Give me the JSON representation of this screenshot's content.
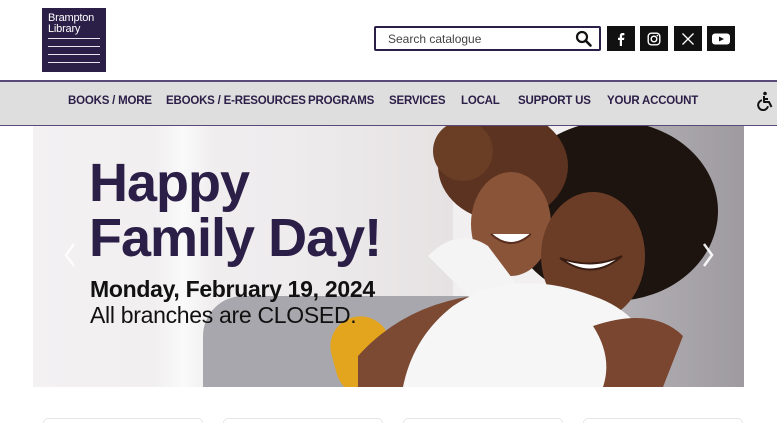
{
  "logo": {
    "line1": "Brampton",
    "line2": "Library",
    "bg_color": "#2b1e47"
  },
  "search": {
    "placeholder": "Search catalogue",
    "value": "",
    "button_icon": "magnifier-icon"
  },
  "social": [
    {
      "name": "facebook",
      "icon": "facebook-icon"
    },
    {
      "name": "instagram",
      "icon": "instagram-icon"
    },
    {
      "name": "x",
      "icon": "x-icon"
    },
    {
      "name": "youtube",
      "icon": "youtube-icon"
    }
  ],
  "nav": {
    "items": [
      {
        "label": "BOOKS / MORE"
      },
      {
        "label": "EBOOKS / E-RESOURCES"
      },
      {
        "label": "PROGRAMS"
      },
      {
        "label": "SERVICES"
      },
      {
        "label": "LOCAL"
      },
      {
        "label": "SUPPORT US"
      },
      {
        "label": "YOUR ACCOUNT"
      }
    ],
    "accessibility_icon": "wheelchair-icon"
  },
  "hero": {
    "title_line1": "Happy",
    "title_line2": "Family Day!",
    "date": "Monday, February 19, 2024",
    "notice": "All branches are CLOSED.",
    "title_color": "#2b1e47",
    "prev_icon": "chevron-left-icon",
    "next_icon": "chevron-right-icon"
  },
  "colors": {
    "brand": "#2b1e47",
    "nav_bg": "#dedede"
  }
}
